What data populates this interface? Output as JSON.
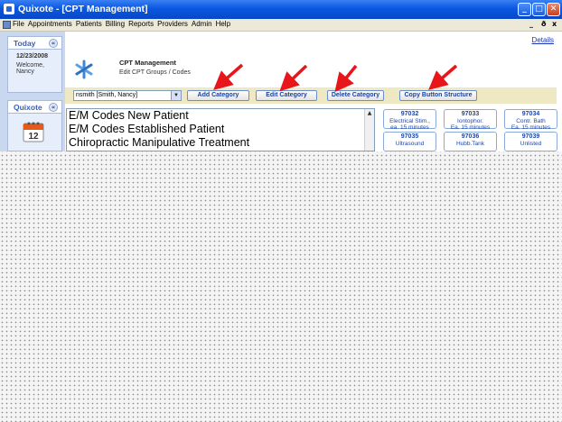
{
  "window": {
    "title": "Quixote - [CPT Management]"
  },
  "titlebar_buttons": {
    "minimize": "_",
    "maximize": "□",
    "close": "✕"
  },
  "menubar": {
    "items": [
      "File",
      "Appointments",
      "Patients",
      "Billing",
      "Reports",
      "Providers",
      "Admin",
      "Help"
    ],
    "mdi_controls": [
      "_",
      "ð",
      "x"
    ]
  },
  "left_pane": {
    "today_panel": {
      "title": "Today",
      "date": "12/23/2008",
      "welcome": "Welcome,",
      "user": "Nancy"
    },
    "quixote_panel": {
      "title": "Quixote",
      "calendar_icon": "calendar-icon",
      "calendar_day": "12"
    }
  },
  "main": {
    "details_link": "Details",
    "header": {
      "title": "CPT Management",
      "subtitle": "Edit CPT Groups / Codes",
      "icon": "asterisk-icon"
    },
    "toolbar": {
      "user_select": "nsmith [Smith, Nancy]",
      "add_category": "Add Category",
      "edit_category": "Edit Category",
      "delete_category": "Delete Category",
      "copy_button_structure": "Copy Button Structure"
    },
    "categories": [
      "E/M Codes New Patient",
      "E/M Codes Established Patient",
      "Chiropractic Manipulative Treatment"
    ],
    "cpt_buttons": [
      {
        "code": "97032",
        "line1": "Electrical Stim.,",
        "line2": "ea. 15 minutes"
      },
      {
        "code": "97033",
        "line1": "Iontophor.",
        "line2": "Ea. 15 minutes"
      },
      {
        "code": "97034",
        "line1": "Contr. Bath",
        "line2": "Ea. 15 minutes"
      },
      {
        "code": "97035",
        "line1": "Ultrasound",
        "line2": ""
      },
      {
        "code": "97036",
        "line1": "Hubb.Tank",
        "line2": ""
      },
      {
        "code": "97039",
        "line1": "Unlisted",
        "line2": ""
      }
    ]
  },
  "colors": {
    "titlebar": "#0a58e0",
    "toolbar_bg": "#efe9c3",
    "arrow": "#e8161b",
    "link": "#1a33b8"
  }
}
